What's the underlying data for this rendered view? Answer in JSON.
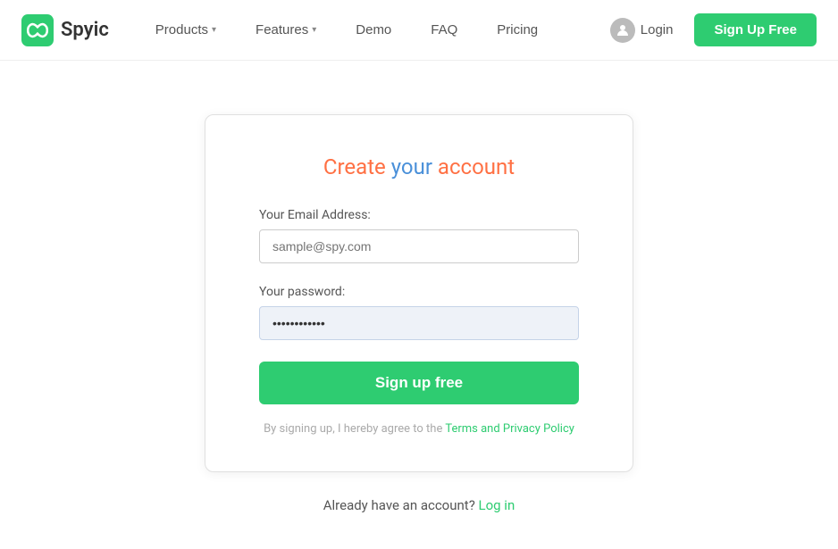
{
  "brand": {
    "name": "Spyic",
    "logo_alt": "Spyic logo"
  },
  "nav": {
    "links": [
      {
        "label": "Products",
        "has_dropdown": true
      },
      {
        "label": "Features",
        "has_dropdown": true
      },
      {
        "label": "Demo",
        "has_dropdown": false
      },
      {
        "label": "FAQ",
        "has_dropdown": false
      },
      {
        "label": "Pricing",
        "has_dropdown": false
      }
    ],
    "login_label": "Login",
    "signup_label": "Sign Up Free"
  },
  "card": {
    "title_part1": "Create ",
    "title_part2": "your",
    "title_part3": " account",
    "email_label": "Your Email Address:",
    "email_placeholder": "sample@spy.com",
    "email_value": "",
    "password_label": "Your password:",
    "password_placeholder": "",
    "password_value": "············",
    "submit_label": "Sign up free",
    "terms_prefix": "By signing up, I hereby agree to the ",
    "terms_link_label": "Terms and Privacy Policy"
  },
  "below_card": {
    "already_text": "Already have an account?",
    "log_in_label": "Log in"
  }
}
